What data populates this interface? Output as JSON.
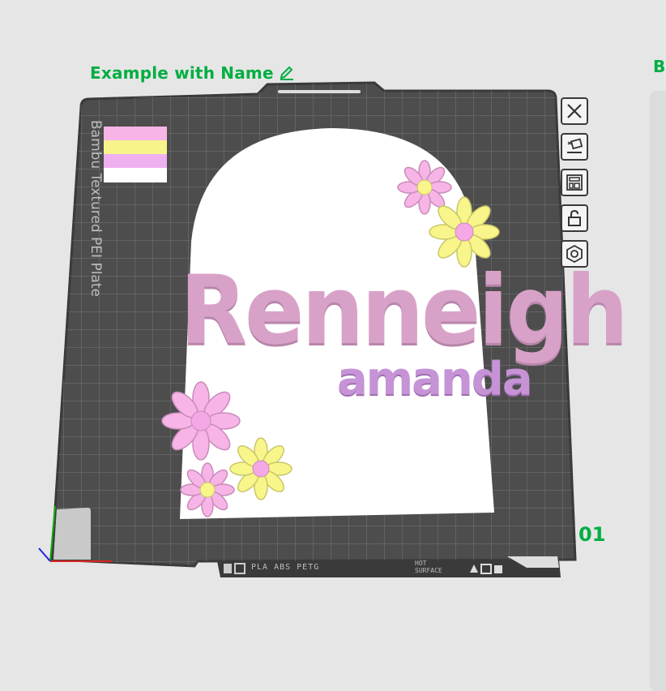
{
  "plate": {
    "title": "Example with Name",
    "number": "01",
    "bed_label": "Bambu Textured PEI Plate",
    "filament_text": "PLA ABS PETG",
    "hot_surface": "HOT SURFACE"
  },
  "edge_label": "B",
  "model": {
    "name": "Renneigh",
    "subtitle": "amanda"
  },
  "toolbar": [
    {
      "name": "close-button",
      "icon": "close-icon"
    },
    {
      "name": "auto-orient-button",
      "icon": "auto-orient-icon"
    },
    {
      "name": "arrange-button",
      "icon": "arrange-icon"
    },
    {
      "name": "lock-button",
      "icon": "lock-icon"
    },
    {
      "name": "plate-settings-button",
      "icon": "hex-nut-icon"
    }
  ],
  "colors": {
    "accent": "#00ae42",
    "bed": "#4d4d4d",
    "pink": "#f4b2e8",
    "yellow": "#f8f58a",
    "lavender": "#d8a2c8",
    "purple": "#c693d6",
    "white": "#ffffff"
  },
  "filament_swatches": [
    "#f7b4e6",
    "#f6f48a",
    "#efb0f0",
    "#ffffff"
  ]
}
